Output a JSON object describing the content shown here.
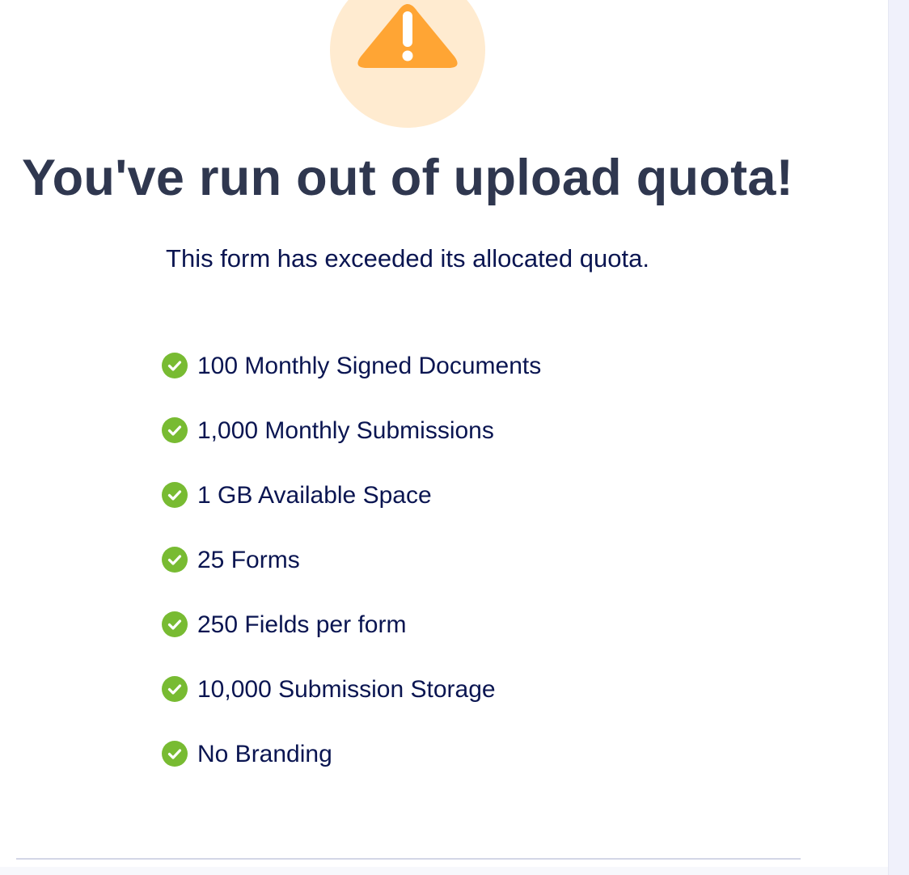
{
  "colors": {
    "warning_orange": "#ffa534",
    "warning_circle_bg": "#ffebd0",
    "title_color": "#2f374f",
    "text_color": "#0a1551",
    "check_green": "#78bb32"
  },
  "header": {
    "icon": "warning-triangle-icon",
    "title": "You've run out of upload quota!",
    "subtitle": "This form has exceeded its allocated quota."
  },
  "features": {
    "icon": "check-circle-icon",
    "items": [
      "100 Monthly Signed Documents",
      "1,000 Monthly Submissions",
      "1 GB Available Space",
      "25 Forms",
      "250 Fields per form",
      "10,000 Submission Storage",
      "No Branding"
    ]
  }
}
